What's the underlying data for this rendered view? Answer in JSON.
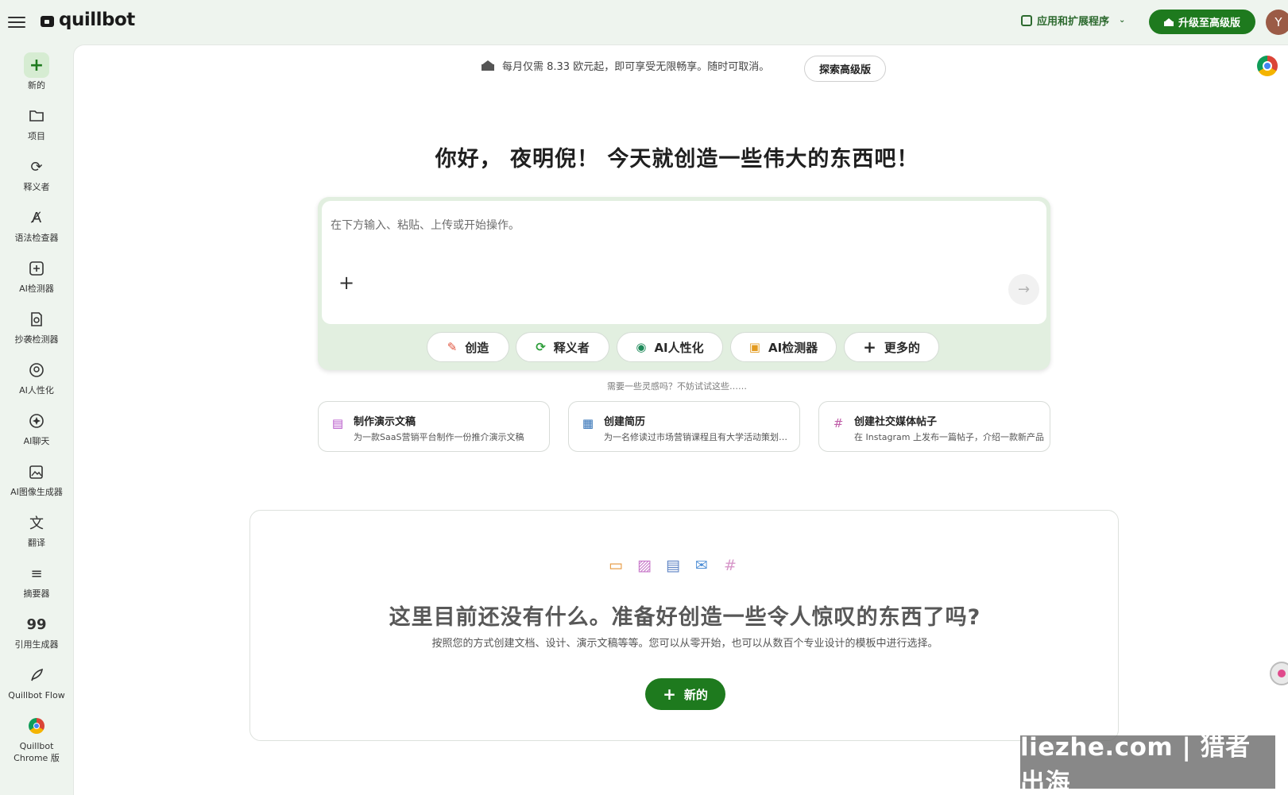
{
  "header": {
    "logo_text": "quillbot",
    "apps_label": "应用和扩展程序",
    "upgrade_label": "升级至高级版",
    "avatar_initial": "Y"
  },
  "sidebar": {
    "items": [
      {
        "label": "新的",
        "icon": "plus-icon"
      },
      {
        "label": "项目",
        "icon": "folder-icon"
      },
      {
        "label": "释义者",
        "icon": "paraphrase-icon"
      },
      {
        "label": "语法检查器",
        "icon": "grammar-icon"
      },
      {
        "label": "AI检测器",
        "icon": "ai-detector-icon"
      },
      {
        "label": "抄袭检测器",
        "icon": "plagiarism-icon"
      },
      {
        "label": "AI人性化",
        "icon": "humanizer-icon"
      },
      {
        "label": "AI聊天",
        "icon": "chat-icon"
      },
      {
        "label": "AI图像生成器",
        "icon": "image-generator-icon"
      },
      {
        "label": "翻译",
        "icon": "translate-icon"
      },
      {
        "label": "摘要器",
        "icon": "summarizer-icon"
      },
      {
        "label": "引用生成器",
        "icon": "citation-icon"
      },
      {
        "label": "Quillbot Flow",
        "icon": "flow-icon"
      },
      {
        "label": "Quillbot Chrome 版",
        "icon": "chrome-icon"
      }
    ]
  },
  "promo": {
    "text": "每月仅需 8.33 欧元起，即可享受无限畅享。随时可取消。",
    "explore_label": "探索高级版"
  },
  "greeting": "你好， 夜明倪！ 今天就创造一些伟大的东西吧！",
  "composer": {
    "placeholder": "在下方输入、粘贴、上传或开始操作。",
    "chips": [
      {
        "label": "创造",
        "icon": "create-icon",
        "color": "#e0533d"
      },
      {
        "label": "释义者",
        "icon": "paraphrase-icon",
        "color": "#2e9e3a"
      },
      {
        "label": "AI人性化",
        "icon": "humanizer-icon",
        "color": "#1f8a5a"
      },
      {
        "label": "AI检测器",
        "icon": "ai-detector-icon",
        "color": "#e39a1f"
      },
      {
        "label": "更多的",
        "icon": "plus-icon",
        "color": "#333333"
      }
    ]
  },
  "hint": "需要一些灵感吗？不妨试试这些……",
  "suggestions": [
    {
      "title": "制作演示文稿",
      "desc": "为一款SaaS营销平台制作一份推介演示文稿",
      "icon": "presentation-icon"
    },
    {
      "title": "创建简历",
      "desc": "为一名修读过市场营销课程且有大学活动策划经验的学生创建简历",
      "icon": "resume-icon"
    },
    {
      "title": "创建社交媒体帖子",
      "desc": "在 Instagram 上发布一篇帖子，介绍一款新产品",
      "icon": "hashtag-icon"
    }
  ],
  "empty": {
    "title": "这里目前还没有什么。准备好创造一些令人惊叹的东西了吗?",
    "desc": "按照您的方式创建文档、设计、演示文稿等等。您可以从零开始，也可以从数百个专业设计的模板中进行选择。",
    "new_label": "新的",
    "icons": [
      "chat-bubble-icon",
      "image-icon",
      "presentation-icon",
      "mail-icon",
      "hashtag-icon"
    ]
  },
  "watermark": "liezhe.com | 猎者出海",
  "colors": {
    "brand_green": "#1e7a1e",
    "page_bg": "#eef4ee",
    "composer_bg": "#e2efe0"
  }
}
